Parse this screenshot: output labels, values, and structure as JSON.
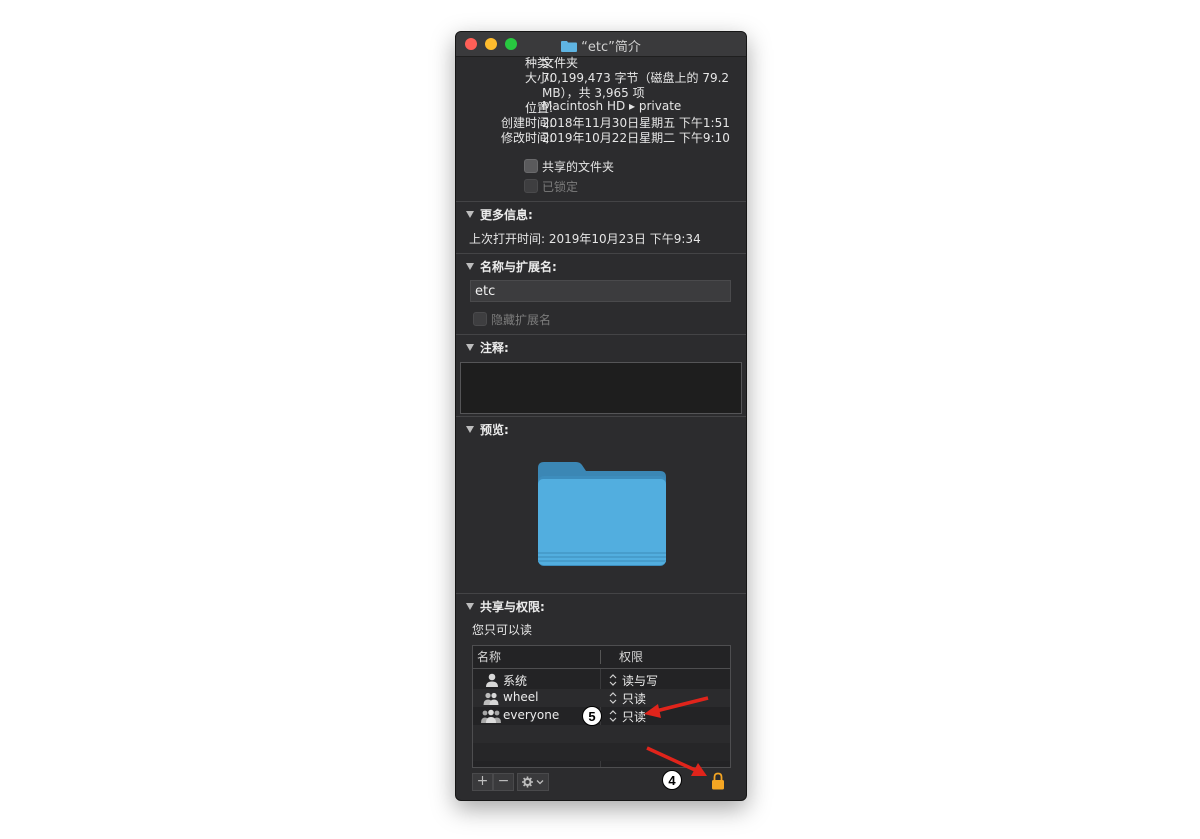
{
  "window": {
    "title": "“etc”简介"
  },
  "general": {
    "kind_label": "种类:",
    "kind_value": "文件夹",
    "size_label": "大小:",
    "size_value_line1": "70,199,473 字节（磁盘上的 79.2",
    "size_value_line2": "MB），共 3,965 项",
    "where_label": "位置:",
    "where_value": "Macintosh HD ▸ private",
    "created_label": "创建时间:",
    "created_value": "2018年11月30日星期五 下午1:51",
    "modified_label": "修改时间:",
    "modified_value": "2019年10月22日星期二 下午9:10",
    "shared_folder_label": "共享的文件夹",
    "locked_label": "已锁定"
  },
  "more_info": {
    "header": "更多信息:",
    "last_opened": "上次打开时间: 2019年10月23日 下午9:34"
  },
  "name_ext": {
    "header": "名称与扩展名:",
    "name_value": "etc",
    "hide_ext_label": "隐藏扩展名"
  },
  "comments": {
    "header": "注释:"
  },
  "preview": {
    "header": "预览:"
  },
  "sharing": {
    "header": "共享与权限:",
    "note": "您只可以读",
    "col_name": "名称",
    "col_priv": "权限",
    "rows": [
      {
        "name": "系统",
        "priv": "读与写",
        "icon": "user-icon"
      },
      {
        "name": "wheel",
        "priv": "只读",
        "icon": "group-icon"
      },
      {
        "name": "everyone",
        "priv": "只读",
        "icon": "everyone-icon"
      }
    ],
    "add_label": "+",
    "remove_label": "−",
    "action_icon": "gear-icon"
  },
  "annotations": {
    "badge_5": "5",
    "badge_4": "4",
    "arrow_color": "#e0241b"
  },
  "colors": {
    "window_bg": "#2c2c2e",
    "folder_blue": "#4aa7d9",
    "lock_orange": "#f5a623"
  }
}
